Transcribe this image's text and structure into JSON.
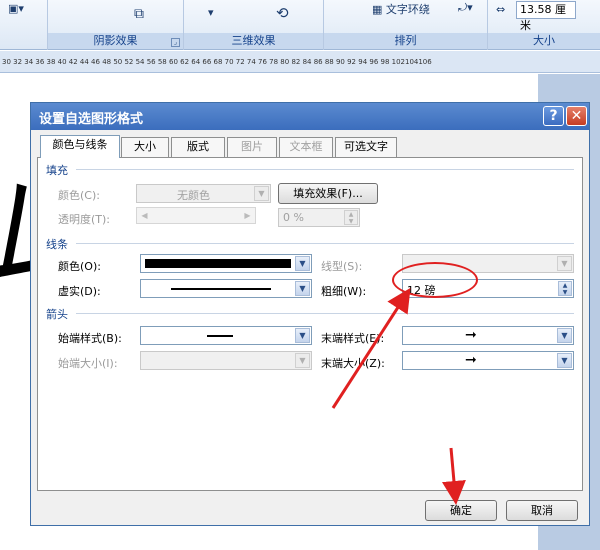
{
  "ribbon": {
    "groups": [
      {
        "label": "阴影效果"
      },
      {
        "label": "三维效果"
      },
      {
        "label": "排列"
      },
      {
        "label": "大小"
      }
    ],
    "wrap_label": "文字环绕",
    "size_value": "13.58 厘米"
  },
  "ruler": {
    "ticks": "30 32 34 36 38 40 42 44 46 48 50 52 54 56 58 60 62 64 66 68 70 72 74 76 78 80 82 84 86 88 90 92 94 96 98 102104106"
  },
  "dialog": {
    "title": "设置自选图形格式",
    "help_label": "?",
    "close_label": "✕",
    "tabs": [
      {
        "label": "颜色与线条",
        "active": true
      },
      {
        "label": "大小"
      },
      {
        "label": "版式"
      },
      {
        "label": "图片",
        "disabled": true
      },
      {
        "label": "文本框",
        "disabled": true
      },
      {
        "label": "可选文字"
      }
    ],
    "fill": {
      "section": "填充",
      "color_label": "颜色(C):",
      "color_value": "无颜色",
      "effects_button": "填充效果(F)...",
      "transparency_label": "透明度(T):",
      "transparency_value": "0 %"
    },
    "line": {
      "section": "线条",
      "color_label": "颜色(O):",
      "style_label": "线型(S):",
      "dashed_label": "虚实(D):",
      "weight_label": "粗细(W):",
      "weight_value": "12 磅"
    },
    "arrows": {
      "section": "箭头",
      "begin_style_label": "始端样式(B):",
      "end_style_label": "末端样式(E):",
      "begin_size_label": "始端大小(I):",
      "end_size_label": "末端大小(Z):"
    },
    "ok_button": "确定",
    "cancel_button": "取消"
  },
  "colors": {
    "annotation": "#e02020",
    "title_bar": "#3b6dbd"
  }
}
